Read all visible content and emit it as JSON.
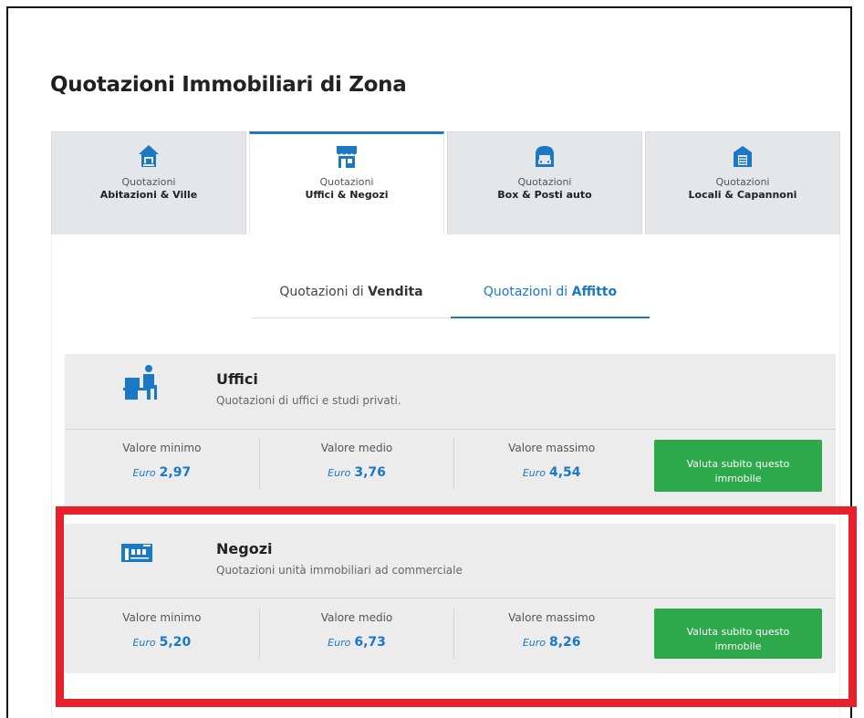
{
  "page": {
    "title_bold": "Quotazioni",
    "title_rest": " Immobiliari di Zona"
  },
  "tabs": [
    {
      "label": "Quotazioni",
      "sub": "Abitazioni & Ville",
      "icon": "house-icon",
      "active": false
    },
    {
      "label": "Quotazioni",
      "sub": "Uffici & Negozi",
      "icon": "shop-icon",
      "active": true
    },
    {
      "label": "Quotazioni",
      "sub": "Box & Posti auto",
      "icon": "car-garage-icon",
      "active": false
    },
    {
      "label": "Quotazioni",
      "sub": "Locali & Capannoni",
      "icon": "warehouse-icon",
      "active": false
    }
  ],
  "subtabs": [
    {
      "prefix": "Quotazioni di ",
      "bold": "Vendita",
      "active": false
    },
    {
      "prefix": "Quotazioni di ",
      "bold": "Affitto",
      "active": true
    }
  ],
  "cards": [
    {
      "title": "Uffici",
      "desc": "Quotazioni di uffici e studi privati.",
      "icon": "office-worker-icon",
      "stats": [
        {
          "label": "Valore minimo",
          "currency": "Euro",
          "value": "2,97"
        },
        {
          "label": "Valore medio",
          "currency": "Euro",
          "value": "3,76"
        },
        {
          "label": "Valore massimo",
          "currency": "Euro",
          "value": "4,54"
        }
      ],
      "cta": "Valuta subito questo immobile"
    },
    {
      "title": "Negozi",
      "desc": "Quotazioni unità immobiliari ad commerciale",
      "icon": "storefront-icon",
      "stats": [
        {
          "label": "Valore minimo",
          "currency": "Euro",
          "value": "5,20"
        },
        {
          "label": "Valore medio",
          "currency": "Euro",
          "value": "6,73"
        },
        {
          "label": "Valore massimo",
          "currency": "Euro",
          "value": "8,26"
        }
      ],
      "cta": "Valuta subito questo immobile"
    }
  ],
  "colors": {
    "accent_blue": "#1b78c4",
    "cta_green": "#2da84b",
    "highlight_red": "#e8202a"
  }
}
